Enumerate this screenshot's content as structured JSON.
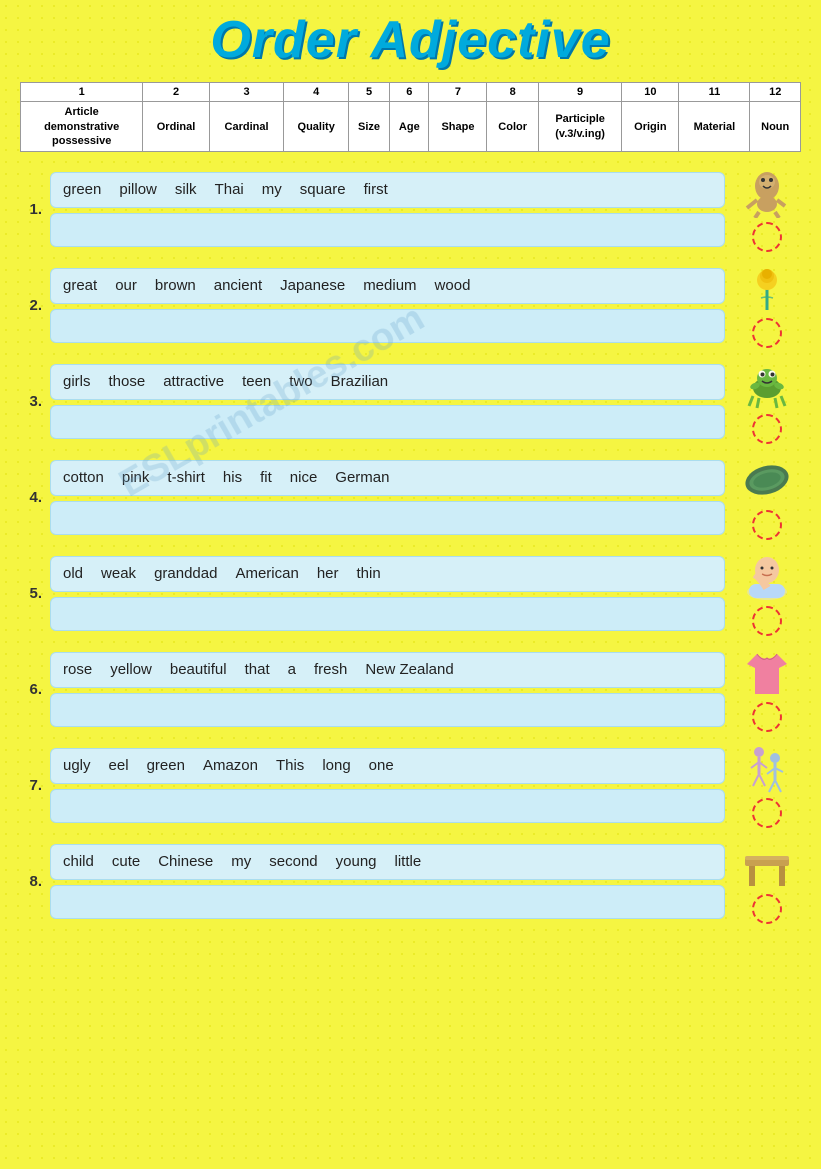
{
  "title": "Order Adjective",
  "header": {
    "columns": [
      {
        "num": "1",
        "label": "Article\ndemonstrative\npossessive"
      },
      {
        "num": "2",
        "label": "Ordinal"
      },
      {
        "num": "3",
        "label": "Cardinal"
      },
      {
        "num": "4",
        "label": "Quality"
      },
      {
        "num": "5",
        "label": "Size"
      },
      {
        "num": "6",
        "label": "Age"
      },
      {
        "num": "7",
        "label": "Shape"
      },
      {
        "num": "8",
        "label": "Color"
      },
      {
        "num": "9",
        "label": "Participle\n(v.3/v.ing)"
      },
      {
        "num": "10",
        "label": "Origin"
      },
      {
        "num": "11",
        "label": "Material"
      },
      {
        "num": "12",
        "label": "Noun"
      }
    ]
  },
  "exercises": [
    {
      "number": "1.",
      "words": [
        "green",
        "pillow",
        "silk",
        "Thai",
        "my",
        "square",
        "first"
      ],
      "image_type": "troll"
    },
    {
      "number": "2.",
      "words": [
        "great",
        "our",
        "brown",
        "ancient",
        "Japanese",
        "medium",
        "wood"
      ],
      "image_type": "rose"
    },
    {
      "number": "3.",
      "words": [
        "girls",
        "those",
        "attractive",
        "teen",
        "two",
        "Brazilian"
      ],
      "image_type": "frog"
    },
    {
      "number": "4.",
      "words": [
        "cotton",
        "pink",
        "t-shirt",
        "his",
        "fit",
        "nice",
        "German"
      ],
      "image_type": "pillow"
    },
    {
      "number": "5.",
      "words": [
        "old",
        "weak",
        "granddad",
        "American",
        "her",
        "thin"
      ],
      "image_type": "baby"
    },
    {
      "number": "6.",
      "words": [
        "rose",
        "yellow",
        "beautiful",
        "that",
        "a",
        "fresh",
        "New Zealand"
      ],
      "image_type": "shirt"
    },
    {
      "number": "7.",
      "words": [
        "ugly",
        "eel",
        "green",
        "Amazon",
        "This",
        "long",
        "one"
      ],
      "image_type": "dancers"
    },
    {
      "number": "8.",
      "words": [
        "child",
        "cute",
        "Chinese",
        "my",
        "second",
        "young",
        "little"
      ],
      "image_type": "table"
    }
  ],
  "watermark": "ESLprintables.com"
}
